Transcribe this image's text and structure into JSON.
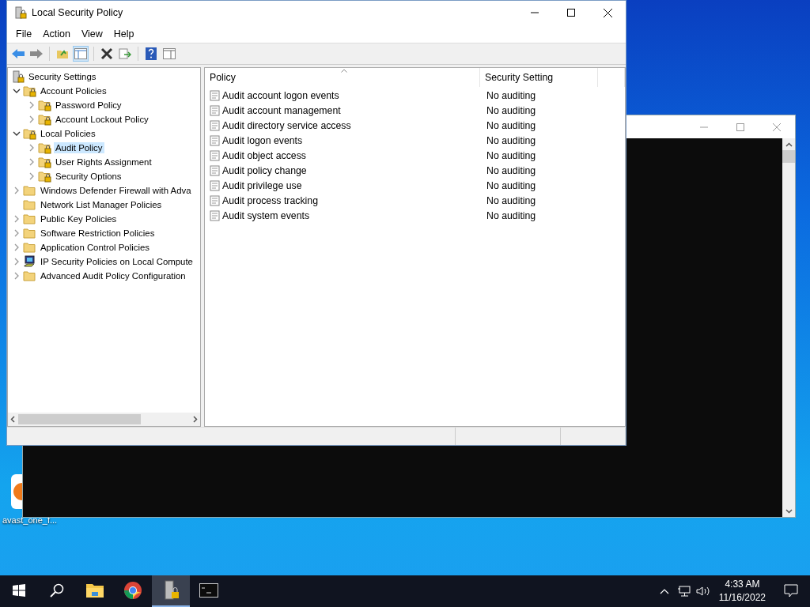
{
  "window": {
    "title": "Local Security Policy"
  },
  "menu": [
    "File",
    "Action",
    "View",
    "Help"
  ],
  "tree": [
    {
      "label": "Security Settings",
      "kind": "root",
      "selected": false,
      "children": [
        {
          "label": "Account Policies",
          "kind": "locked",
          "expanded": true,
          "selected": false,
          "children": [
            {
              "label": "Password Policy",
              "kind": "locked",
              "expanded": false,
              "selected": false
            },
            {
              "label": "Account Lockout Policy",
              "kind": "locked",
              "expanded": false,
              "selected": false
            }
          ]
        },
        {
          "label": "Local Policies",
          "kind": "locked",
          "expanded": true,
          "selected": false,
          "children": [
            {
              "label": "Audit Policy",
              "kind": "locked",
              "expanded": false,
              "selected": true
            },
            {
              "label": "User Rights Assignment",
              "kind": "locked",
              "expanded": false,
              "selected": false
            },
            {
              "label": "Security Options",
              "kind": "locked",
              "expanded": false,
              "selected": false
            }
          ]
        },
        {
          "label": "Windows Defender Firewall with Adva",
          "kind": "folder",
          "expanded": false,
          "selected": false
        },
        {
          "label": "Network List Manager Policies",
          "kind": "folder",
          "selected": false
        },
        {
          "label": "Public Key Policies",
          "kind": "folder",
          "expanded": false,
          "selected": false
        },
        {
          "label": "Software Restriction Policies",
          "kind": "folder",
          "expanded": false,
          "selected": false
        },
        {
          "label": "Application Control Policies",
          "kind": "folder",
          "expanded": false,
          "selected": false
        },
        {
          "label": "IP Security Policies on Local Compute",
          "kind": "computer",
          "expanded": false,
          "selected": false
        },
        {
          "label": "Advanced Audit Policy Configuration",
          "kind": "folder",
          "expanded": false,
          "selected": false
        }
      ]
    }
  ],
  "table": {
    "columns": [
      "Policy",
      "Security Setting"
    ],
    "rows": [
      {
        "policy": "Audit account logon events",
        "setting": "No auditing"
      },
      {
        "policy": "Audit account management",
        "setting": "No auditing"
      },
      {
        "policy": "Audit directory service access",
        "setting": "No auditing"
      },
      {
        "policy": "Audit logon events",
        "setting": "No auditing"
      },
      {
        "policy": "Audit object access",
        "setting": "No auditing"
      },
      {
        "policy": "Audit policy change",
        "setting": "No auditing"
      },
      {
        "policy": "Audit privilege use",
        "setting": "No auditing"
      },
      {
        "policy": "Audit process tracking",
        "setting": "No auditing"
      },
      {
        "policy": "Audit system events",
        "setting": "No auditing"
      }
    ]
  },
  "desktop_icons": [
    {
      "label": "avast_one_f..."
    }
  ],
  "taskbar": {
    "apps": [
      {
        "kind": "explorer",
        "selected": false
      },
      {
        "kind": "chrome",
        "selected": false
      },
      {
        "kind": "policy",
        "selected": true
      },
      {
        "kind": "console",
        "selected": false
      }
    ],
    "time": "4:33 AM",
    "date": "11/16/2022"
  }
}
